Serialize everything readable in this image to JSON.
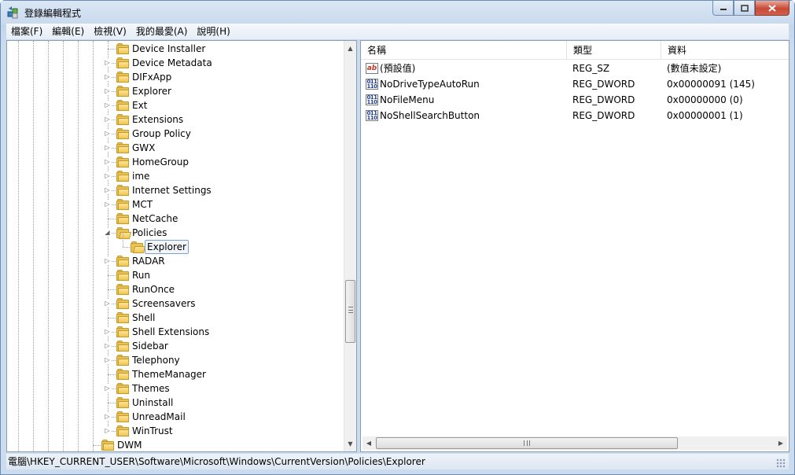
{
  "window": {
    "title": "登錄編輯程式"
  },
  "menu": [
    "檔案(F)",
    "編輯(E)",
    "檢視(V)",
    "我的最愛(A)",
    "說明(H)"
  ],
  "tree": {
    "items": [
      {
        "label": "Device Installer",
        "expander": false,
        "state": "closed"
      },
      {
        "label": "Device Metadata",
        "expander": true,
        "state": "closed"
      },
      {
        "label": "DIFxApp",
        "expander": true,
        "state": "closed"
      },
      {
        "label": "Explorer",
        "expander": true,
        "state": "closed"
      },
      {
        "label": "Ext",
        "expander": true,
        "state": "closed"
      },
      {
        "label": "Extensions",
        "expander": true,
        "state": "closed"
      },
      {
        "label": "Group Policy",
        "expander": true,
        "state": "closed"
      },
      {
        "label": "GWX",
        "expander": true,
        "state": "closed"
      },
      {
        "label": "HomeGroup",
        "expander": true,
        "state": "closed"
      },
      {
        "label": "ime",
        "expander": true,
        "state": "closed"
      },
      {
        "label": "Internet Settings",
        "expander": true,
        "state": "closed"
      },
      {
        "label": "MCT",
        "expander": true,
        "state": "closed"
      },
      {
        "label": "NetCache",
        "expander": false,
        "state": "closed"
      },
      {
        "label": "Policies",
        "expander": true,
        "state": "expanded"
      },
      {
        "label": "Explorer",
        "expander": false,
        "state": "selected"
      },
      {
        "label": "RADAR",
        "expander": true,
        "state": "closed"
      },
      {
        "label": "Run",
        "expander": false,
        "state": "closed"
      },
      {
        "label": "RunOnce",
        "expander": false,
        "state": "closed"
      },
      {
        "label": "Screensavers",
        "expander": true,
        "state": "closed"
      },
      {
        "label": "Shell",
        "expander": false,
        "state": "closed"
      },
      {
        "label": "Shell Extensions",
        "expander": true,
        "state": "closed"
      },
      {
        "label": "Sidebar",
        "expander": true,
        "state": "closed"
      },
      {
        "label": "Telephony",
        "expander": true,
        "state": "closed"
      },
      {
        "label": "ThemeManager",
        "expander": false,
        "state": "closed"
      },
      {
        "label": "Themes",
        "expander": true,
        "state": "closed"
      },
      {
        "label": "Uninstall",
        "expander": false,
        "state": "closed"
      },
      {
        "label": "UnreadMail",
        "expander": true,
        "state": "closed"
      },
      {
        "label": "WinTrust",
        "expander": true,
        "state": "closed"
      },
      {
        "label": "DWM",
        "expander": false,
        "state": "closed"
      }
    ]
  },
  "list": {
    "columns": [
      "名稱",
      "類型",
      "資料"
    ],
    "rows": [
      {
        "name": "(預設值)",
        "type": "REG_SZ",
        "data": "(數值未設定)",
        "icon": "string-value-icon",
        "icon_text": "ab"
      },
      {
        "name": "NoDriveTypeAutoRun",
        "type": "REG_DWORD",
        "data": "0x00000091 (145)",
        "icon": "dword-value-icon",
        "icon_text": "011 110"
      },
      {
        "name": "NoFileMenu",
        "type": "REG_DWORD",
        "data": "0x00000000 (0)",
        "icon": "dword-value-icon",
        "icon_text": "011 110"
      },
      {
        "name": "NoShellSearchButton",
        "type": "REG_DWORD",
        "data": "0x00000001 (1)",
        "icon": "dword-value-icon",
        "icon_text": "011 110"
      }
    ]
  },
  "statusbar": {
    "path": "電腦\\HKEY_CURRENT_USER\\Software\\Microsoft\\Windows\\CurrentVersion\\Policies\\Explorer"
  },
  "colors": {
    "selection_border": "#7da2ce",
    "folder": "#e8c35a",
    "frame": "#c2d5ea"
  }
}
